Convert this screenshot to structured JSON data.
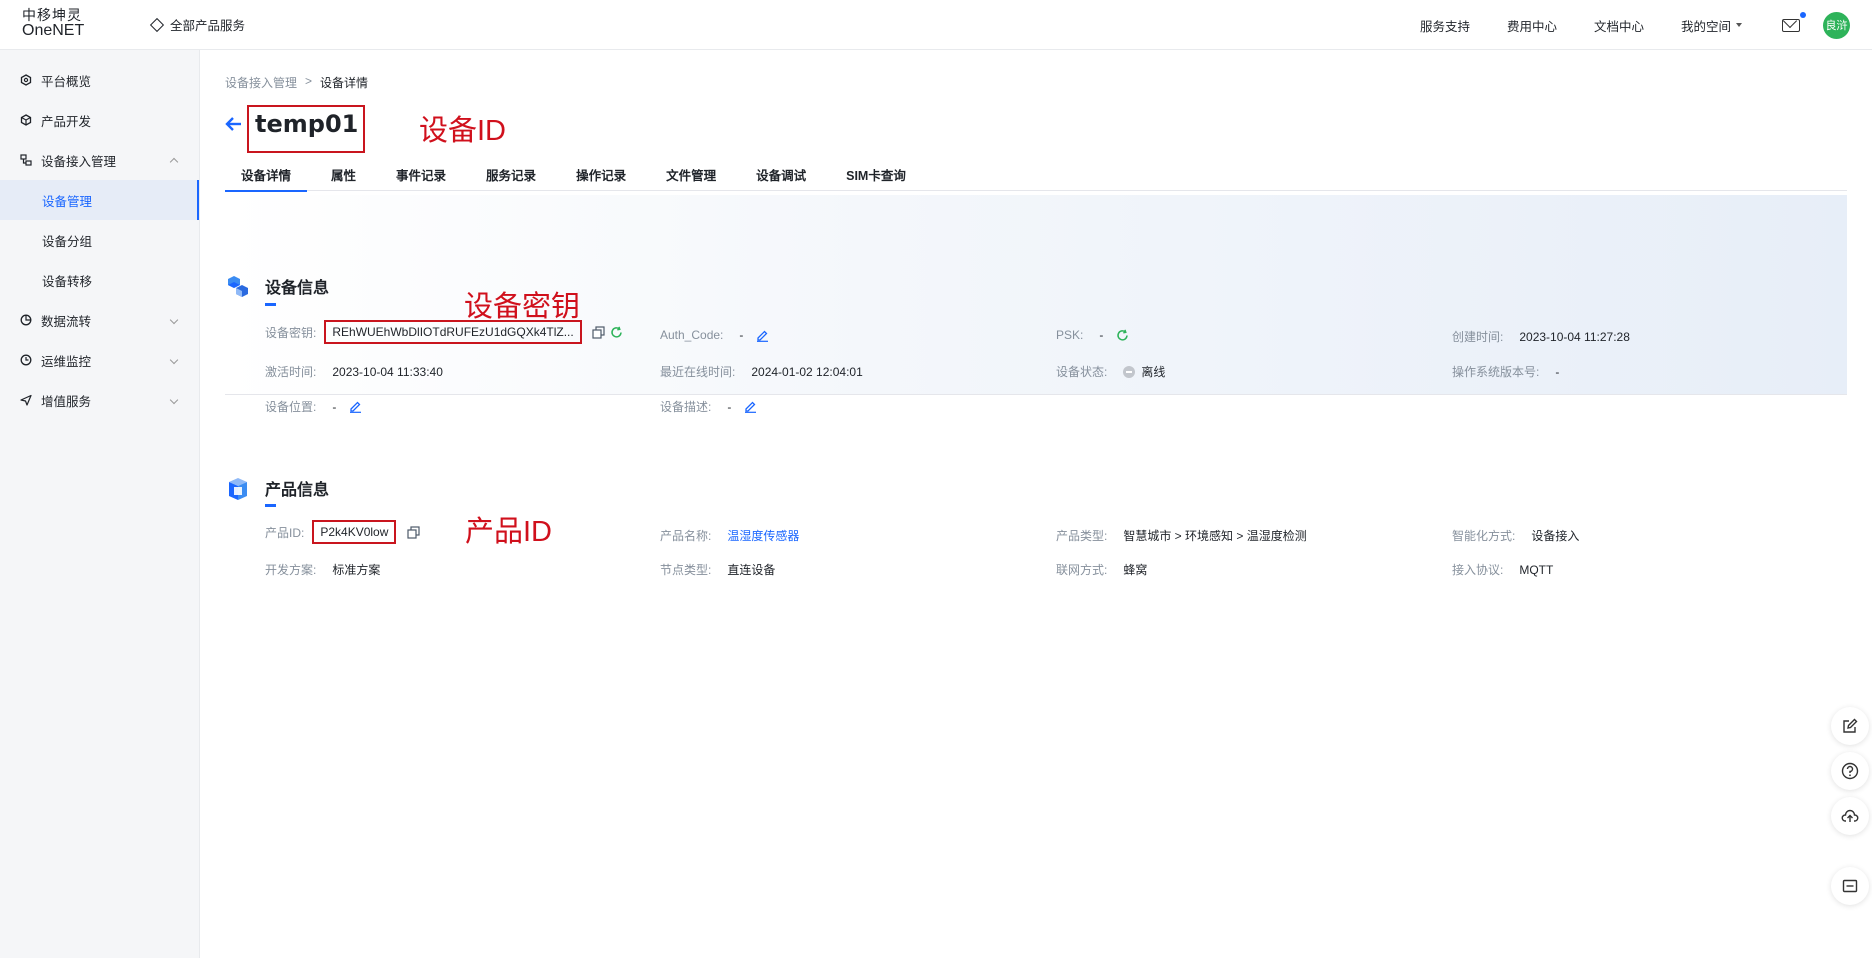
{
  "header": {
    "logo_cn": "中移坤灵",
    "logo_en": "OneNET",
    "all_products": "全部产品服务",
    "nav": [
      "服务支持",
      "费用中心",
      "文档中心"
    ],
    "my_space": "我的空间",
    "avatar_text": "良浒"
  },
  "sidebar": {
    "items": [
      {
        "label": "平台概览"
      },
      {
        "label": "产品开发"
      },
      {
        "label": "设备接入管理"
      },
      {
        "label": "数据流转"
      },
      {
        "label": "运维监控"
      },
      {
        "label": "增值服务"
      }
    ],
    "sub": [
      {
        "label": "设备管理"
      },
      {
        "label": "设备分组"
      },
      {
        "label": "设备转移"
      }
    ]
  },
  "breadcrumb": {
    "parent": "设备接入管理",
    "sep": ">",
    "current": "设备详情"
  },
  "device_title": "temp01",
  "annotations": {
    "device_id": "设备ID",
    "device_key": "设备密钥",
    "product_id": "产品ID"
  },
  "tabs": [
    "设备详情",
    "属性",
    "事件记录",
    "服务记录",
    "操作记录",
    "文件管理",
    "设备调试",
    "SIM卡查询"
  ],
  "device_info": {
    "title": "设备信息",
    "key_label": "设备密钥:",
    "key_value": "REhWUEhWbDlIOTdRUFEzU1dGQXk4TlZ...",
    "auth_label": "Auth_Code:",
    "auth_value": "-",
    "psk_label": "PSK:",
    "psk_value": "-",
    "created_label": "创建时间:",
    "created_value": "2023-10-04 11:27:28",
    "activated_label": "激活时间:",
    "activated_value": "2023-10-04 11:33:40",
    "last_online_label": "最近在线时间:",
    "last_online_value": "2024-01-02 12:04:01",
    "status_label": "设备状态:",
    "status_value": "离线",
    "os_label": "操作系统版本号:",
    "os_value": "-",
    "location_label": "设备位置:",
    "location_value": "-",
    "desc_label": "设备描述:",
    "desc_value": "-"
  },
  "product_info": {
    "title": "产品信息",
    "pid_label": "产品ID:",
    "pid_value": "P2k4KV0low",
    "name_label": "产品名称:",
    "name_value": "温湿度传感器",
    "type_label": "产品类型:",
    "type_value": "智慧城市 > 环境感知 > 温湿度检测",
    "smart_label": "智能化方式:",
    "smart_value": "设备接入",
    "plan_label": "开发方案:",
    "plan_value": "标准方案",
    "node_label": "节点类型:",
    "node_value": "直连设备",
    "network_label": "联网方式:",
    "network_value": "蜂窝",
    "protocol_label": "接入协议:",
    "protocol_value": "MQTT"
  },
  "colors": {
    "accent": "#1a66ff",
    "annotation": "#d0101c",
    "avatar": "#2eb35a"
  }
}
